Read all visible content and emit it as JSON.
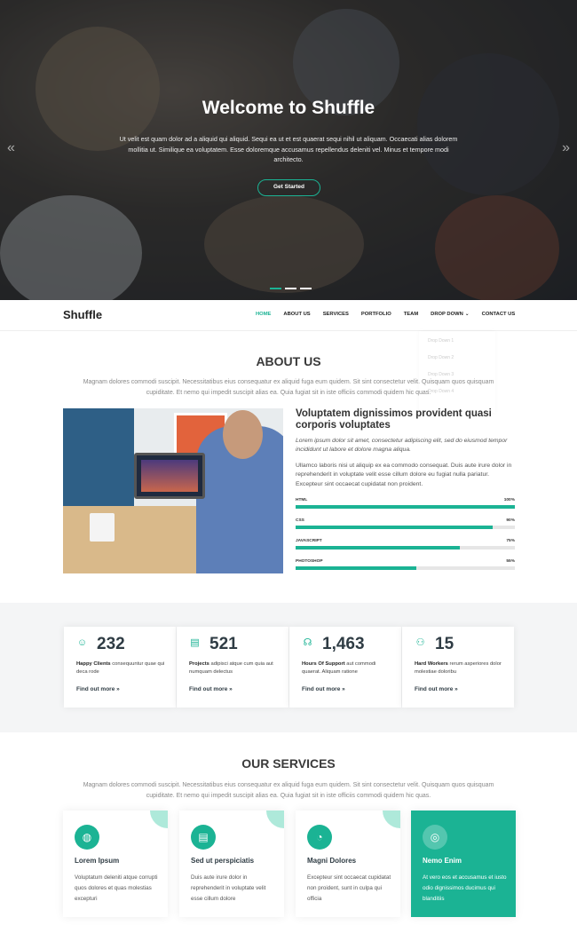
{
  "hero": {
    "title": "Welcome to Shuffle",
    "text": "Ut velit est quam dolor ad a aliquid qui aliquid. Sequi ea ut et est quaerat sequi nihil ut aliquam. Occaecati alias dolorem mollitia ut. Similique ea voluptatem. Esse doloremque accusamus repellendus deleniti vel. Minus et tempore modi architecto.",
    "button": "Get Started",
    "prev_icon": "chevron-double-left-icon",
    "next_icon": "chevron-double-right-icon",
    "slide_count": 3,
    "active_slide": 1
  },
  "nav": {
    "logo": "Shuffle",
    "items": [
      "HOME",
      "ABOUT US",
      "SERVICES",
      "PORTFOLIO",
      "TEAM",
      "DROP DOWN",
      "CONTACT US"
    ],
    "active": "HOME",
    "dropdown_items": [
      "Drop Down 1",
      "Drop Down 2",
      "Drop Down 3",
      "Drop Down 4"
    ]
  },
  "about": {
    "title": "ABOUT US",
    "subtitle": "Magnam dolores commodi suscipit. Necessitatibus eius consequatur ex aliquid fuga eum quidem. Sit sint consectetur velit. Quisquam quos quisquam cupiditate. Et nemo qui impedit suscipit alias ea. Quia fugiat sit in iste officiis commodi quidem hic quas.",
    "heading": "Voluptatem dignissimos provident quasi corporis voluptates",
    "italic": "Lorem ipsum dolor sit amet, consectetur adipiscing elit, sed do eiusmod tempor incididunt ut labore et dolore magna aliqua.",
    "paragraph": "Ullamco laboris nisi ut aliquip ex ea commodo consequat. Duis aute irure dolor in reprehenderit in voluptate velit esse cillum dolore eu fugiat nulla pariatur. Excepteur sint occaecat cupidatat non proident.",
    "skills": [
      {
        "name": "HTML",
        "value": "100%",
        "level": 100
      },
      {
        "name": "CSS",
        "value": "90%",
        "level": 90
      },
      {
        "name": "JAVASCRIPT",
        "value": "75%",
        "level": 75
      },
      {
        "name": "PHOTOSHOP",
        "value": "55%",
        "level": 55
      }
    ]
  },
  "counts": [
    {
      "icon": "smile-icon",
      "number": "232",
      "bold": "Happy Clients",
      "text": " consequuntur quae qui deca rode",
      "more": "Find out more »"
    },
    {
      "icon": "journal-icon",
      "number": "521",
      "bold": "Projects",
      "text": " adipisci atque cum quia aut numquam delectus",
      "more": "Find out more »"
    },
    {
      "icon": "headset-icon",
      "number": "1,463",
      "bold": "Hours Of Support",
      "text": " aut commodi quaerat. Aliquam ratione",
      "more": "Find out more »"
    },
    {
      "icon": "people-icon",
      "number": "15",
      "bold": "Hard Workers",
      "text": " rerum asperiores dolor molestiae doloribu",
      "more": "Find out more »"
    }
  ],
  "services": {
    "title": "OUR SERVICES",
    "subtitle": "Magnam dolores commodi suscipit. Necessitatibus eius consequatur ex aliquid fuga eum quidem. Sit sint consectetur velit. Quisquam quos quisquam cupiditate. Et nemo qui impedit suscipit alias ea. Quia fugiat sit in iste officiis commodi quidem hic quas.",
    "items": [
      {
        "icon": "dribbble-icon",
        "title": "Lorem Ipsum",
        "text": "Voluptatum deleniti atque corrupti quos dolores et quas molestias excepturi"
      },
      {
        "icon": "file-icon",
        "title": "Sed ut perspiciatis",
        "text": "Duis aute irure dolor in reprehenderit in voluptate velit esse cillum dolore"
      },
      {
        "icon": "speedometer-icon",
        "title": "Magni Dolores",
        "text": "Excepteur sint occaecat cupidatat non proident, sunt in culpa qui officia"
      },
      {
        "icon": "globe-icon",
        "title": "Nemo Enim",
        "text": "At vero eos et accusamus et iusto odio dignissimos ducimus qui blanditiis"
      }
    ]
  },
  "colors": {
    "accent": "#1bb394",
    "heading": "#2f3c44"
  }
}
